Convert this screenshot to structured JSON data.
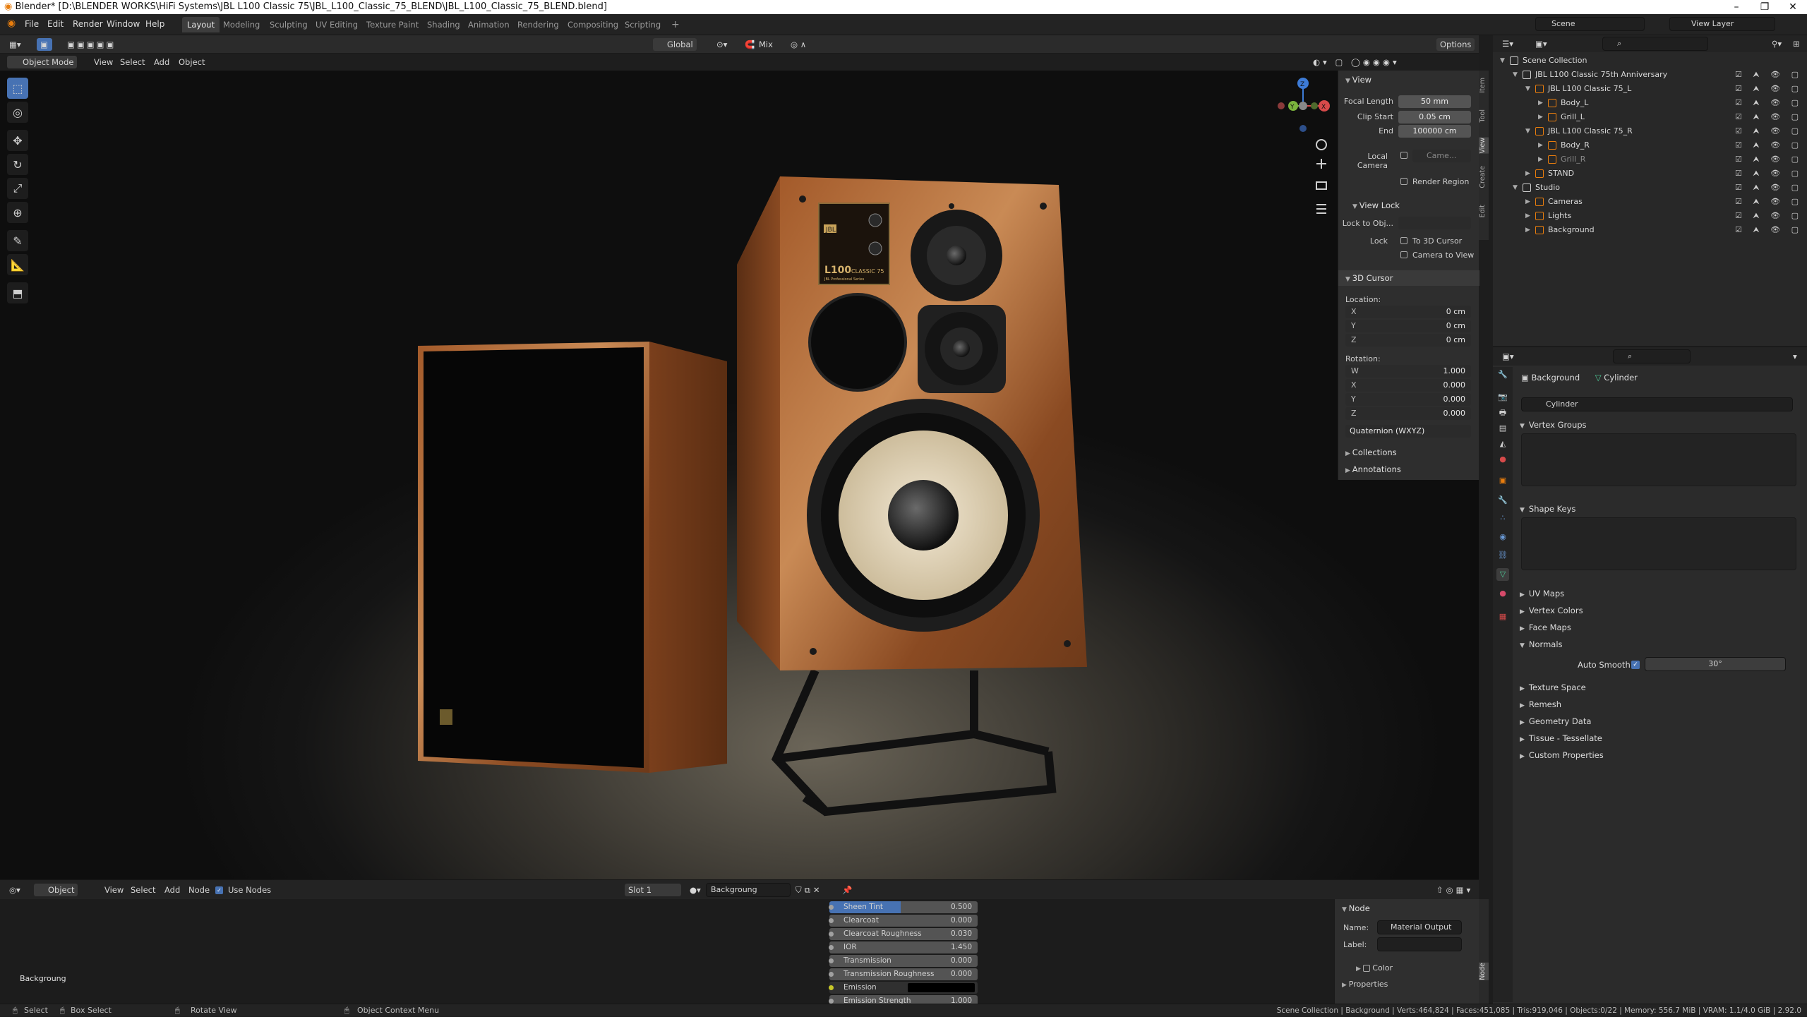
{
  "window": {
    "title": "Blender* [D:\\BLENDER WORKS\\HiFi Systems\\JBL L100 Classic 75\\JBL_L100_Classic_75_BLEND\\JBL_L100_Classic_75_BLEND.blend]",
    "min": "–",
    "max": "❐",
    "close": "✕"
  },
  "menu": [
    "File",
    "Edit",
    "Render",
    "Window",
    "Help"
  ],
  "workspaces": [
    "Layout",
    "Modeling",
    "Sculpting",
    "UV Editing",
    "Texture Paint",
    "Shading",
    "Animation",
    "Rendering",
    "Compositing",
    "Scripting"
  ],
  "active_workspace": "Layout",
  "add_workspace": "+",
  "transform_orientation": "Global",
  "mix_label": "Mix",
  "scene": "Scene",
  "view_layer": "View Layer",
  "options_label": "Options",
  "viewport_header": {
    "mode": "Object Mode",
    "menus": [
      "View",
      "Select",
      "Add",
      "Object"
    ]
  },
  "npanel": {
    "tabs": [
      "Item",
      "Tool",
      "View",
      "Create",
      "Edit"
    ],
    "view_title": "View",
    "focal_length_label": "Focal Length",
    "focal_length": "50 mm",
    "clip_start_label": "Clip Start",
    "clip_start": "0.05 cm",
    "end_label": "End",
    "end": "100000 cm",
    "local_camera_label": "Local Camera",
    "local_camera_value": "Came...",
    "render_region": "Render Region",
    "view_lock": "View Lock",
    "lock_to_obj": "Lock to Obj...",
    "lock_label": "Lock",
    "to_3d_cursor": "To 3D Cursor",
    "camera_to_view": "Camera to View",
    "cursor_title": "3D Cursor",
    "location_label": "Location:",
    "loc": [
      {
        "axis": "X",
        "value": "0 cm"
      },
      {
        "axis": "Y",
        "value": "0 cm"
      },
      {
        "axis": "Z",
        "value": "0 cm"
      }
    ],
    "rotation_label": "Rotation:",
    "rot": [
      {
        "axis": "W",
        "value": "1.000"
      },
      {
        "axis": "X",
        "value": "0.000"
      },
      {
        "axis": "Y",
        "value": "0.000"
      },
      {
        "axis": "Z",
        "value": "0.000"
      }
    ],
    "rotation_mode": "Quaternion (WXYZ)",
    "collections": "Collections",
    "annotations": "Annotations"
  },
  "speaker_badge": {
    "brand": "JBL",
    "model_big": "L100",
    "model_small": "CLASSIC 75",
    "sub": "JBL Professional Series"
  },
  "gizmo": {
    "z": "Z",
    "y": "Y",
    "x": "X"
  },
  "outliner": {
    "rows": [
      {
        "label": "Scene Collection",
        "level": 0
      },
      {
        "label": "JBL L100 Classic 75th Anniversary",
        "level": 1
      },
      {
        "label": "JBL L100 Classic 75_L",
        "level": 2
      },
      {
        "label": "Body_L",
        "level": 3
      },
      {
        "label": "Grill_L",
        "level": 3
      },
      {
        "label": "JBL L100 Classic 75_R",
        "level": 2
      },
      {
        "label": "Body_R",
        "level": 3
      },
      {
        "label": "Grill_R",
        "level": 3
      },
      {
        "label": "STAND",
        "level": 2
      },
      {
        "label": "Studio",
        "level": 1
      },
      {
        "label": "Cameras",
        "level": 2
      },
      {
        "label": "Lights",
        "level": 2
      },
      {
        "label": "Background",
        "level": 2
      }
    ]
  },
  "properties": {
    "breadcrumb_object": "Background",
    "breadcrumb_mesh": "Cylinder",
    "mesh_name": "Cylinder",
    "sections": {
      "vertex_groups": "Vertex Groups",
      "shape_keys": "Shape Keys",
      "uv_maps": "UV Maps",
      "vertex_colors": "Vertex Colors",
      "face_maps": "Face Maps",
      "normals": "Normals",
      "texture_space": "Texture Space",
      "remesh": "Remesh",
      "geometry_data": "Geometry Data",
      "tissue": "Tissue - Tessellate",
      "custom_properties": "Custom Properties"
    },
    "auto_smooth_label": "Auto Smooth",
    "auto_smooth_angle": "30°"
  },
  "node_header": {
    "editor": "Object",
    "menus": [
      "View",
      "Select",
      "Add",
      "Node"
    ],
    "use_nodes": "Use Nodes",
    "slot": "Slot 1",
    "material": "Backgroung"
  },
  "node_editor": {
    "corner_label": "Backgroung",
    "rows": [
      {
        "label": "Sheen Tint",
        "value": "0.500",
        "highlight": true
      },
      {
        "label": "Clearcoat",
        "value": "0.000"
      },
      {
        "label": "Clearcoat Roughness",
        "value": "0.030"
      },
      {
        "label": "IOR",
        "value": "1.450"
      },
      {
        "label": "Transmission",
        "value": "0.000"
      },
      {
        "label": "Transmission Roughness",
        "value": "0.000"
      },
      {
        "label": "Emission",
        "value": ""
      },
      {
        "label": "Emission Strength",
        "value": "1.000"
      }
    ]
  },
  "node_side": {
    "title": "Node",
    "name_label": "Name:",
    "name_value": "Material Output",
    "label_label": "Label:",
    "color_label": "Color",
    "properties_label": "Properties",
    "tabs": [
      "Node"
    ]
  },
  "statusbar": {
    "select": "Select",
    "box_select": "Box Select",
    "rotate_view": "Rotate View",
    "context_menu": "Object Context Menu",
    "stats": "Scene Collection | Background | Verts:464,824 | Faces:451,085 | Tris:919,046 | Objects:0/22 | Memory: 556.7 MiB | VRAM: 1.1/4.0 GiB | 2.92.0"
  },
  "colors": {
    "accent": "#4772b3",
    "walnut": "#8a4a22",
    "header": "#232323",
    "panel": "#303030",
    "cone": "#e4d6bd"
  }
}
